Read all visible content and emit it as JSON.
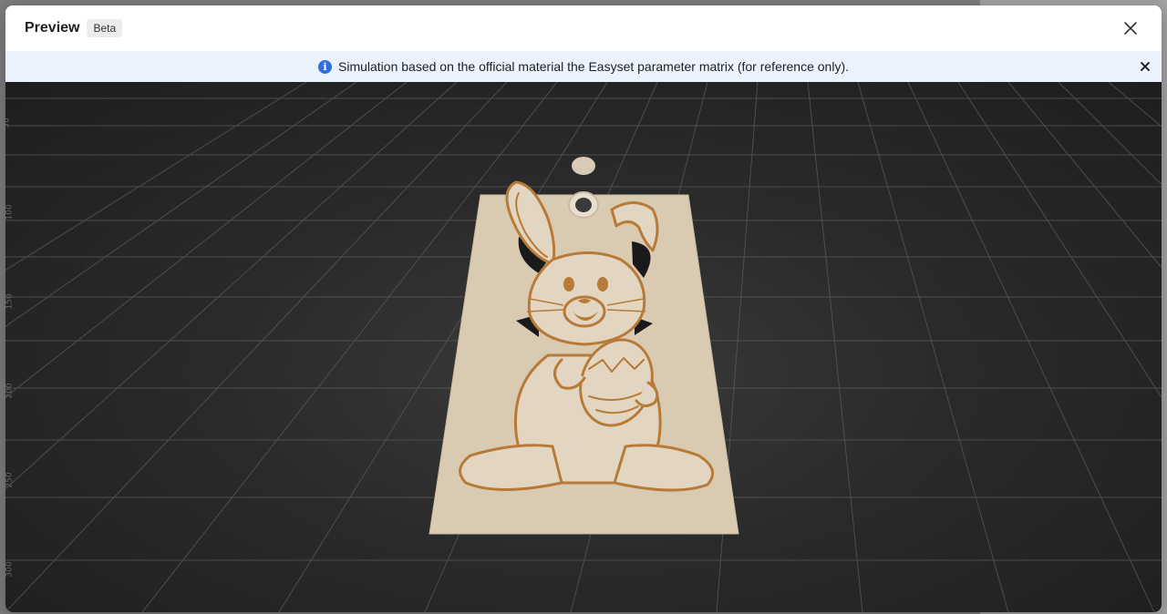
{
  "modal": {
    "title": "Preview",
    "badge": "Beta"
  },
  "banner": {
    "info_icon": "info-icon",
    "text": "Simulation based on the official material the Easyset parameter matrix (for reference only)."
  },
  "viewport": {
    "model_description_icon": "bunny-3d-model",
    "ruler_labels": [
      "50",
      "100",
      "150",
      "200",
      "250",
      "300"
    ]
  },
  "colors": {
    "accent": "#2f6fe0",
    "banner_bg": "#eaf3fd",
    "plate": "#d9cbb2",
    "engraving": "#b87a37",
    "viewport_bg": "#2a2a2a"
  }
}
